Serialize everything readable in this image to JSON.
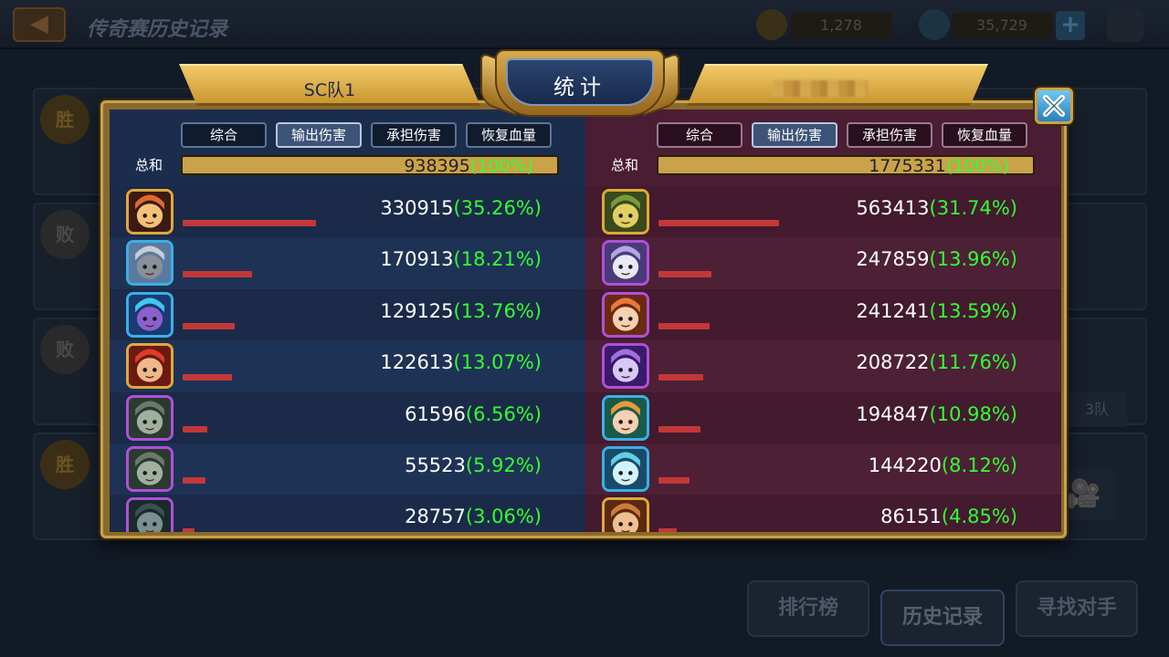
{
  "background": {
    "title": "传奇赛历史记录",
    "gold": "1,278",
    "gems": "35,729",
    "results": [
      "胜",
      "败",
      "败",
      "胜"
    ],
    "side_label": "3队",
    "buttons": {
      "rank": "排行榜",
      "history": "历史记录",
      "find": "寻找对手"
    }
  },
  "header": {
    "left_team": "SC队1",
    "title": "统计",
    "right_team": ""
  },
  "tabs": [
    "综合",
    "输出伤害",
    "承担伤害",
    "恢复血量"
  ],
  "active_tab": "输出伤害",
  "total_label": "总和",
  "left": {
    "total_value": "938395",
    "total_pct": "(100%)",
    "rows": [
      {
        "value": "330915",
        "pct": "(35.26%)",
        "share": 35.26,
        "frame": "gold",
        "hero": "flame-demon-hero-icon"
      },
      {
        "value": "170913",
        "pct": "(18.21%)",
        "share": 18.21,
        "frame": "blue",
        "hero": "knight-helmet-hero-icon"
      },
      {
        "value": "129125",
        "pct": "(13.76%)",
        "share": 13.76,
        "frame": "blue",
        "hero": "ice-golem-hero-icon"
      },
      {
        "value": "122613",
        "pct": "(13.07%)",
        "share": 13.07,
        "frame": "gold",
        "hero": "red-hair-hero-icon"
      },
      {
        "value": "61596",
        "pct": "(6.56%)",
        "share": 6.56,
        "frame": "purple",
        "hero": "armored-soldier-hero-icon"
      },
      {
        "value": "55523",
        "pct": "(5.92%)",
        "share": 5.92,
        "frame": "purple",
        "hero": "armored-soldier-hero-icon"
      },
      {
        "value": "28757",
        "pct": "(3.06%)",
        "share": 3.06,
        "frame": "purple",
        "hero": "dark-armor-hero-icon"
      }
    ]
  },
  "right": {
    "total_value": "1775331",
    "total_pct": "(100%)",
    "rows": [
      {
        "value": "563413",
        "pct": "(31.74%)",
        "share": 31.74,
        "frame": "gold",
        "hero": "green-orc-hero-icon"
      },
      {
        "value": "247859",
        "pct": "(13.96%)",
        "share": 13.96,
        "frame": "purple",
        "hero": "pale-elf-hero-icon"
      },
      {
        "value": "241241",
        "pct": "(13.59%)",
        "share": 13.59,
        "frame": "purple",
        "hero": "orange-hair-girl-hero-icon"
      },
      {
        "value": "208722",
        "pct": "(11.76%)",
        "share": 11.76,
        "frame": "purple",
        "hero": "violet-sorceress-hero-icon"
      },
      {
        "value": "194847",
        "pct": "(10.98%)",
        "share": 10.98,
        "frame": "blue",
        "hero": "green-elf-hero-icon"
      },
      {
        "value": "144220",
        "pct": "(8.12%)",
        "share": 8.12,
        "frame": "blue",
        "hero": "ice-spirit-hero-icon"
      },
      {
        "value": "86151",
        "pct": "(4.85%)",
        "share": 4.85,
        "frame": "gold",
        "hero": "masked-bandit-hero-icon"
      }
    ]
  },
  "colors": {
    "left_panel": "#1b2d4d",
    "right_panel": "#4a1d33",
    "bar": "#c23838",
    "pct_text": "#33ff33",
    "gold_frame": "#c9a24a"
  }
}
